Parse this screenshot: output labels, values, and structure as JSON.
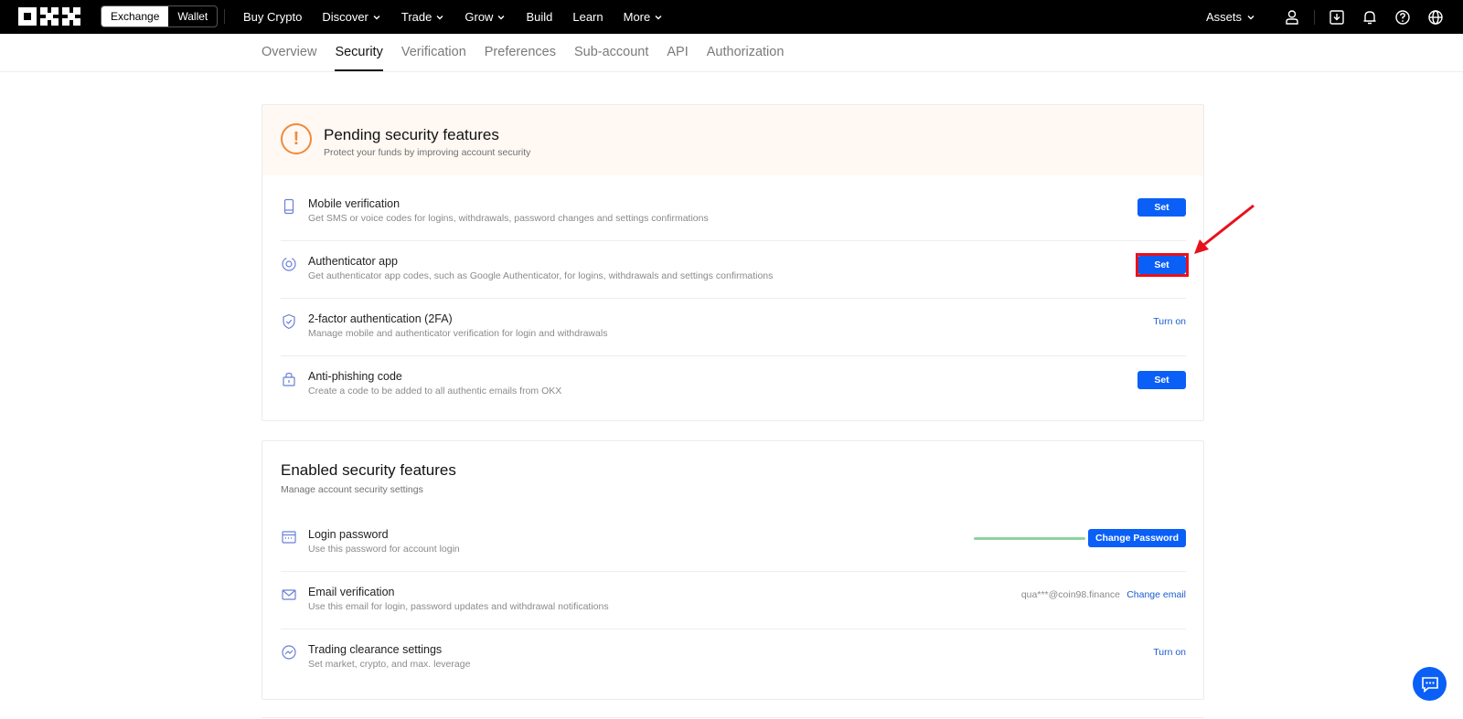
{
  "topbar": {
    "segment": [
      "Exchange",
      "Wallet"
    ],
    "nav": [
      {
        "label": "Buy Crypto",
        "dropdown": false
      },
      {
        "label": "Discover",
        "dropdown": true
      },
      {
        "label": "Trade",
        "dropdown": true
      },
      {
        "label": "Grow",
        "dropdown": true
      },
      {
        "label": "Build",
        "dropdown": false
      },
      {
        "label": "Learn",
        "dropdown": false
      },
      {
        "label": "More",
        "dropdown": true
      }
    ],
    "assets_label": "Assets",
    "icons": [
      "user-icon",
      "download-icon",
      "bell-icon",
      "help-icon",
      "globe-icon"
    ]
  },
  "subtabs": [
    "Overview",
    "Security",
    "Verification",
    "Preferences",
    "Sub-account",
    "API",
    "Authorization"
  ],
  "active_subtab": "Security",
  "pending": {
    "title": "Pending security features",
    "subtitle": "Protect your funds by improving account security",
    "rows": [
      {
        "icon": "phone-icon",
        "title": "Mobile verification",
        "desc": "Get SMS or voice codes for logins, withdrawals, password changes and settings confirmations",
        "action": "Set",
        "action_type": "button"
      },
      {
        "icon": "authenticator-icon",
        "title": "Authenticator app",
        "desc": "Get authenticator app codes, such as Google Authenticator, for logins, withdrawals and settings confirmations",
        "action": "Set",
        "action_type": "button",
        "highlighted": true
      },
      {
        "icon": "shield-icon",
        "title": "2-factor authentication (2FA)",
        "desc": "Manage mobile and authenticator verification for login and withdrawals",
        "action": "Turn on",
        "action_type": "link"
      },
      {
        "icon": "lock-icon",
        "title": "Anti-phishing code",
        "desc": "Create a code to be added to all authentic emails from OKX",
        "action": "Set",
        "action_type": "button"
      }
    ]
  },
  "enabled": {
    "title": "Enabled security features",
    "subtitle": "Manage account security settings",
    "rows": [
      {
        "icon": "password-icon",
        "title": "Login password",
        "desc": "Use this password for account login",
        "action": "Change Password",
        "action_type": "button"
      },
      {
        "icon": "mail-icon",
        "title": "Email verification",
        "desc": "Use this email for login, password updates and withdrawal notifications",
        "value": "qua***@coin98.finance",
        "action": "Change email",
        "action_type": "link"
      },
      {
        "icon": "trading-icon",
        "title": "Trading clearance settings",
        "desc": "Set market, crypto, and max. leverage",
        "action": "Turn on",
        "action_type": "link"
      }
    ]
  },
  "colors": {
    "primary": "#0a5ff7",
    "highlight": "#e8111b",
    "warning": "#f08a3a",
    "strength": "#8fd19e"
  }
}
